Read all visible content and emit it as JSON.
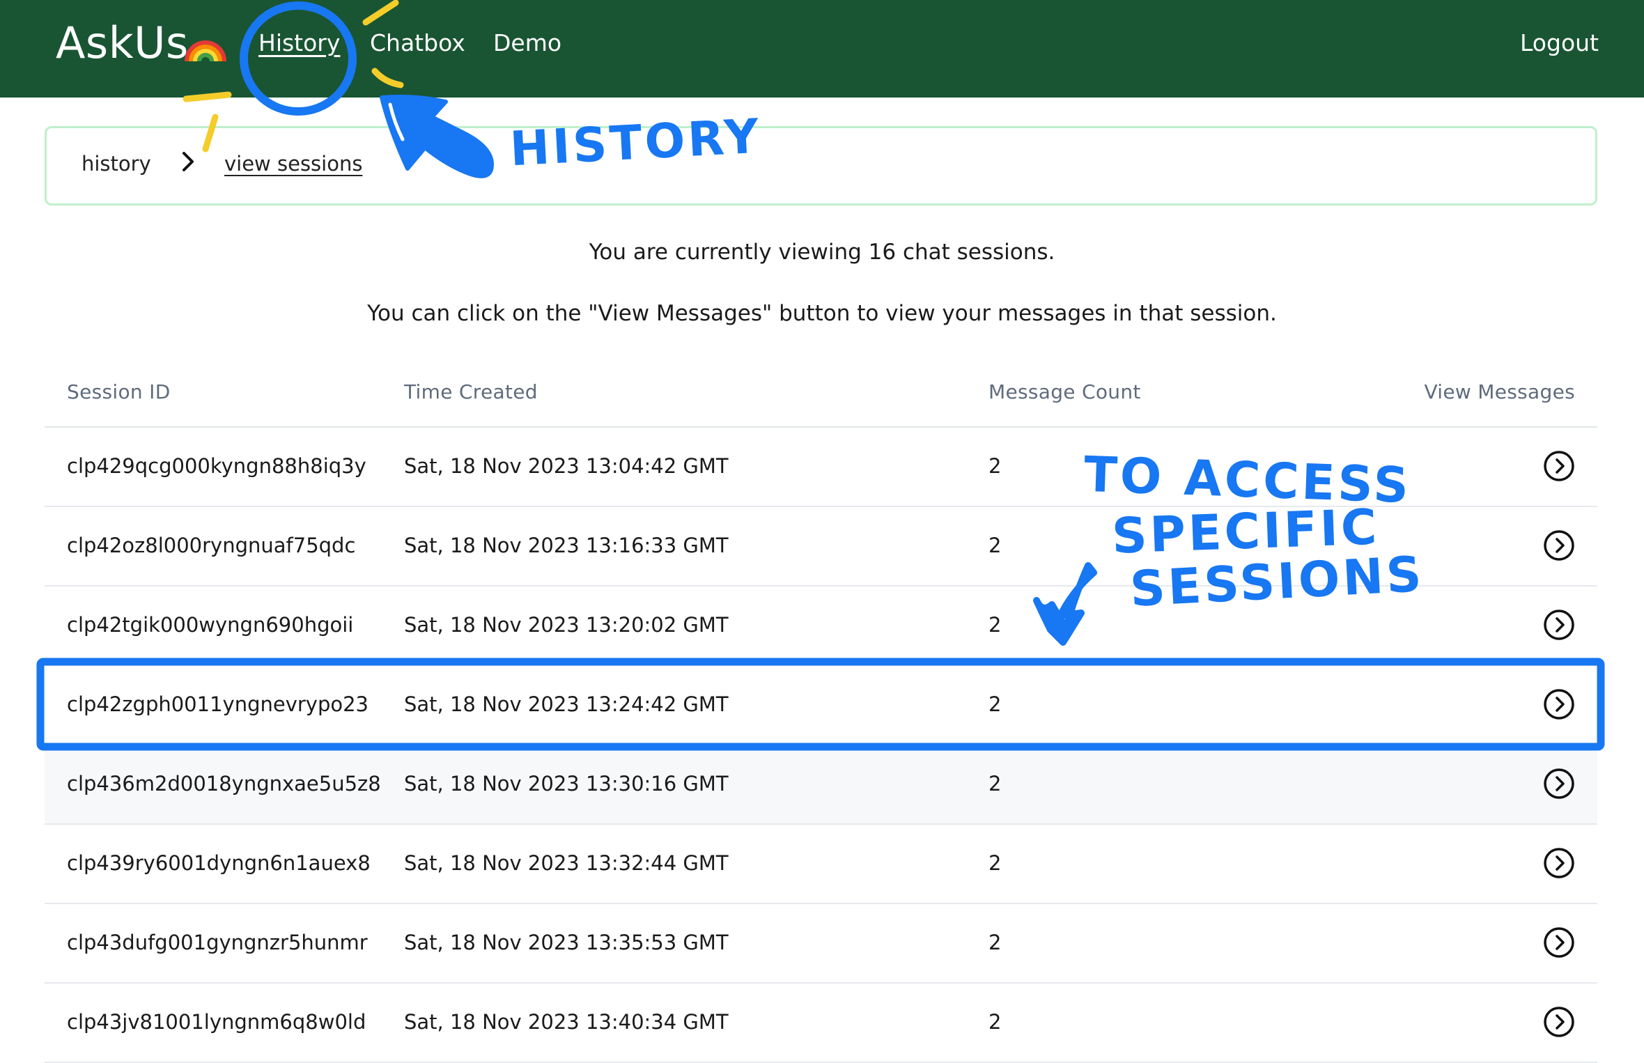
{
  "nav": {
    "brand": "AskUs",
    "links": [
      "History",
      "Chatbox",
      "Demo"
    ],
    "logout": "Logout"
  },
  "breadcrumb": {
    "items": [
      "history",
      "view sessions"
    ]
  },
  "intro": {
    "line1": "You are currently viewing 16 chat sessions.",
    "line2": "You can click on the \"View Messages\" button to view your messages in that session."
  },
  "table": {
    "headers": [
      "Session ID",
      "Time Created",
      "Message Count",
      "View Messages"
    ],
    "rows": [
      {
        "id": "clp429qcg000kyngn88h8iq3y",
        "time": "Sat, 18 Nov 2023 13:04:42 GMT",
        "count": "2"
      },
      {
        "id": "clp42oz8l000ryngnuaf75qdc",
        "time": "Sat, 18 Nov 2023 13:16:33 GMT",
        "count": "2"
      },
      {
        "id": "clp42tgik000wyngn690hgoii",
        "time": "Sat, 18 Nov 2023 13:20:02 GMT",
        "count": "2"
      },
      {
        "id": "clp42zgph0011yngnevrypo23",
        "time": "Sat, 18 Nov 2023 13:24:42 GMT",
        "count": "2"
      },
      {
        "id": "clp436m2d0018yngnxae5u5z8",
        "time": "Sat, 18 Nov 2023 13:30:16 GMT",
        "count": "2"
      },
      {
        "id": "clp439ry6001dyngn6n1auex8",
        "time": "Sat, 18 Nov 2023 13:32:44 GMT",
        "count": "2"
      },
      {
        "id": "clp43dufg001gyngnzr5hunmr",
        "time": "Sat, 18 Nov 2023 13:35:53 GMT",
        "count": "2"
      },
      {
        "id": "clp43jv81001lyngnm6q8w0ld",
        "time": "Sat, 18 Nov 2023 13:40:34 GMT",
        "count": "2"
      }
    ]
  },
  "annotations": {
    "history_label": "HISTORY",
    "sessions_label": [
      "TO ACCESS",
      "SPECIFIC",
      "SESSIONS"
    ],
    "color": "#1877f2",
    "sparkle_color": "#f5cd2a"
  },
  "colors": {
    "topbar": "#195533",
    "breadcrumb_border": "#bff0cb"
  }
}
